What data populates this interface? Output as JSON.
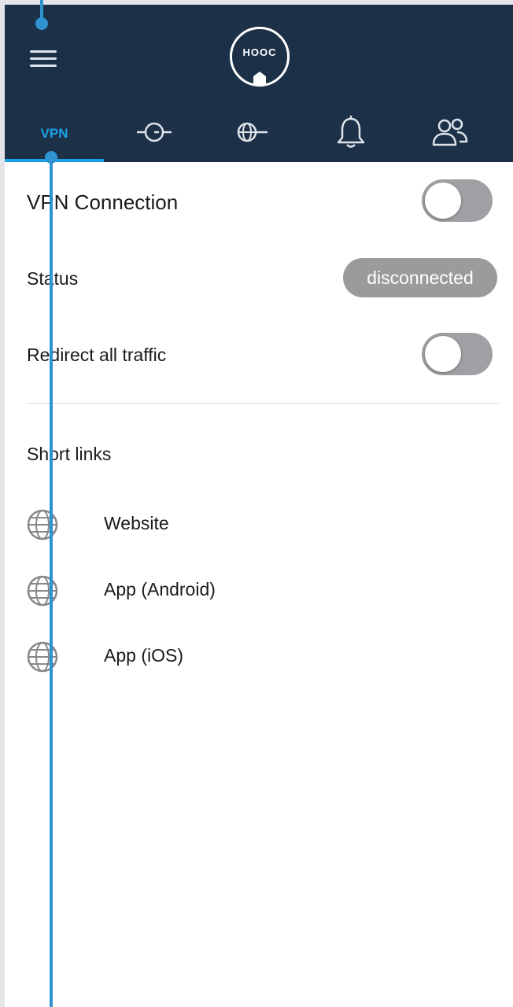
{
  "header": {
    "logo_text": "HOOC"
  },
  "tabs": [
    {
      "label": "VPN",
      "active": true
    },
    {
      "icon": "tunnel-icon"
    },
    {
      "icon": "globe-arrow-icon"
    },
    {
      "icon": "bell-icon"
    },
    {
      "icon": "users-icon"
    }
  ],
  "vpn": {
    "connection_label": "VPN Connection",
    "connection_on": false,
    "status_label": "Status",
    "status_value": "disconnected",
    "redirect_label": "Redirect all traffic",
    "redirect_on": false
  },
  "short_links": {
    "heading": "Short links",
    "items": [
      {
        "label": "Website",
        "icon": "globe-icon"
      },
      {
        "label": "App (Android)",
        "icon": "globe-icon"
      },
      {
        "label": "App (iOS)",
        "icon": "globe-icon"
      }
    ]
  },
  "colors": {
    "header_bg": "#1c3048",
    "accent": "#1ba3e8",
    "toggle_off": "#a0a0a4",
    "status_badge": "#9b9b9b"
  }
}
